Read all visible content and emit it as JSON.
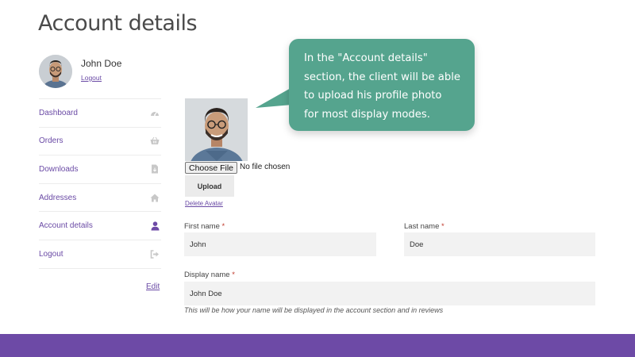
{
  "page": {
    "title": "Account details"
  },
  "user": {
    "name": "John Doe",
    "logout_label": "Logout"
  },
  "sidebar": {
    "items": [
      {
        "label": "Dashboard",
        "icon": "dashboard-icon",
        "active": false
      },
      {
        "label": "Orders",
        "icon": "basket-icon",
        "active": false
      },
      {
        "label": "Downloads",
        "icon": "file-download-icon",
        "active": false
      },
      {
        "label": "Addresses",
        "icon": "home-icon",
        "active": false
      },
      {
        "label": "Account details",
        "icon": "user-icon",
        "active": true
      },
      {
        "label": "Logout",
        "icon": "sign-out-icon",
        "active": false
      }
    ],
    "edit_label": "Edit"
  },
  "avatar_upload": {
    "choose_file_label": "Choose File",
    "no_file_text": "No file chosen",
    "upload_label": "Upload",
    "delete_label": "Delete Avatar"
  },
  "form": {
    "first_name": {
      "label": "First name",
      "required_mark": "*",
      "value": "John"
    },
    "last_name": {
      "label": "Last name",
      "required_mark": "*",
      "value": "Doe"
    },
    "display_name": {
      "label": "Display name",
      "required_mark": "*",
      "value": "John Doe",
      "hint": "This will be how your name will be displayed in the account section and in reviews"
    }
  },
  "callout": {
    "lines": [
      "In the \"Account details\"",
      "section, the client will be able",
      "to upload his profile photo",
      "for most display modes."
    ]
  },
  "colors": {
    "accent": "#6d4aa6",
    "link": "#6a4aa5",
    "callout_bg": "#55a48e",
    "input_bg": "#f2f2f2",
    "icon_muted": "#c8c8c8",
    "icon_active": "#6d4aa6"
  }
}
